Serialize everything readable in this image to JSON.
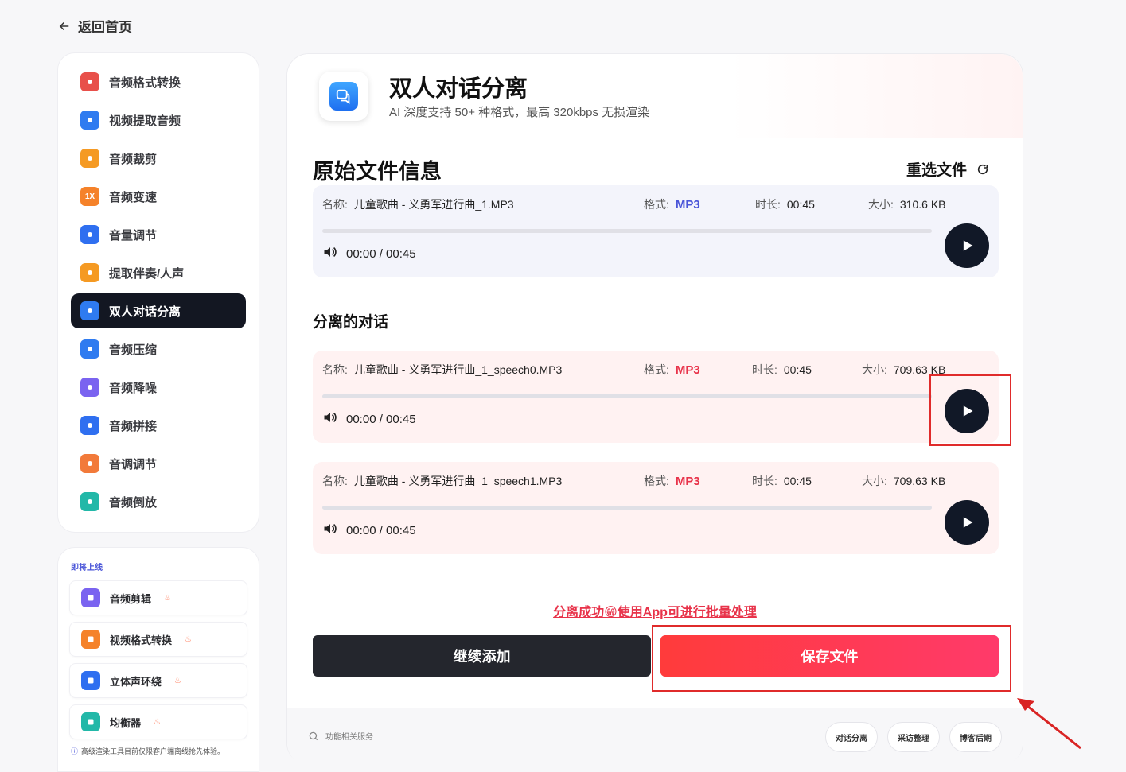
{
  "back_label": "返回首页",
  "sidebar": {
    "items": [
      {
        "label": "音频格式转换",
        "icon": "audio-convert-icon",
        "color": "#e8504a",
        "active": false
      },
      {
        "label": "视频提取音频",
        "icon": "video-extract-icon",
        "color": "#2f7bf0",
        "active": false
      },
      {
        "label": "音频裁剪",
        "icon": "audio-cut-icon",
        "color": "#f59a23",
        "active": false
      },
      {
        "label": "音频变速",
        "icon": "speed-icon",
        "color": "#f5822a",
        "glyph": "1X",
        "active": false
      },
      {
        "label": "音量调节",
        "icon": "volume-adjust-icon",
        "color": "#2f6ff0",
        "active": false
      },
      {
        "label": "提取伴奏/人声",
        "icon": "accompaniment-icon",
        "color": "#f59a23",
        "active": false
      },
      {
        "label": "双人对话分离",
        "icon": "dialogue-icon",
        "color": "#2f7bf0",
        "active": true
      },
      {
        "label": "音频压缩",
        "icon": "compress-icon",
        "color": "#2f7bf0",
        "active": false
      },
      {
        "label": "音频降噪",
        "icon": "denoise-icon",
        "color": "#7a63f0",
        "active": false
      },
      {
        "label": "音频拼接",
        "icon": "join-icon",
        "color": "#2f6ff0",
        "active": false
      },
      {
        "label": "音调调节",
        "icon": "pitch-icon",
        "color": "#f27a3a",
        "active": false
      },
      {
        "label": "音频倒放",
        "icon": "reverse-icon",
        "color": "#22b8a8",
        "active": false
      }
    ]
  },
  "coming_soon": {
    "title": "即将上线",
    "items": [
      {
        "label": "音频剪辑",
        "icon": "scissors-icon",
        "color": "#7a63f0"
      },
      {
        "label": "视频格式转换",
        "icon": "video-format-icon",
        "color": "#f5822a"
      },
      {
        "label": "立体声环绕",
        "icon": "cube-icon",
        "color": "#2f6ff0"
      },
      {
        "label": "均衡器",
        "icon": "equalizer-icon",
        "color": "#22b8a8"
      }
    ],
    "note": "高级渲染工具目前仅限客户端离线抢先体验。"
  },
  "header": {
    "title": "双人对话分离",
    "subtitle": "AI 深度支持 50+ 种格式，最高 320kbps 无损渲染"
  },
  "original": {
    "title": "原始文件信息",
    "reselect_label": "重选文件",
    "name_label": "名称:",
    "format_label": "格式:",
    "duration_label": "时长:",
    "size_label": "大小:",
    "file": {
      "name": "儿童歌曲 - 义勇军进行曲_1.MP3",
      "format": "MP3",
      "duration": "00:45",
      "size": "310.6 KB",
      "time": "00:00 / 00:45"
    }
  },
  "separated": {
    "title": "分离的对话",
    "files": [
      {
        "name": "儿童歌曲 - 义勇军进行曲_1_speech0.MP3",
        "format": "MP3",
        "duration": "00:45",
        "size": "709.63 KB",
        "time": "00:00 / 00:45"
      },
      {
        "name": "儿童歌曲 - 义勇军进行曲_1_speech1.MP3",
        "format": "MP3",
        "duration": "00:45",
        "size": "709.63 KB",
        "time": "00:00 / 00:45"
      }
    ]
  },
  "success_text": "分离成功😁使用App可进行批量处理",
  "buttons": {
    "continue": "继续添加",
    "save": "保存文件"
  },
  "footer": {
    "search_placeholder": "功能相关服务",
    "chips": [
      "对话分离",
      "采访整理",
      "博客后期"
    ]
  }
}
